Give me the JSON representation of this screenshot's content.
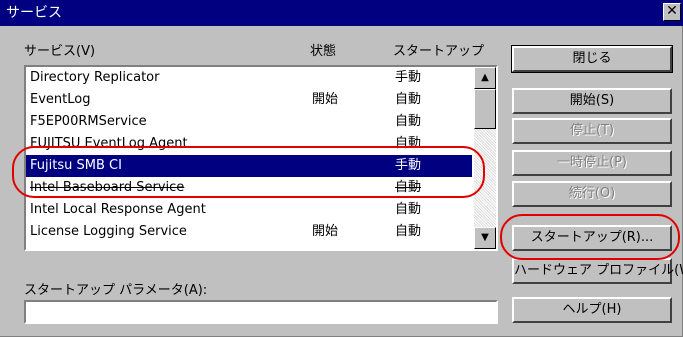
{
  "window": {
    "title": "サービス",
    "close_glyph": "✕"
  },
  "list": {
    "label": "サービス(V)",
    "headers": {
      "name": "サービス(V)",
      "status": "状態",
      "startup": "スタートアップ"
    },
    "rows": [
      {
        "name": "Directory Replicator",
        "status": "",
        "startup": "手動"
      },
      {
        "name": "EventLog",
        "status": "開始",
        "startup": "自動"
      },
      {
        "name": "F5EP00RMService",
        "status": "",
        "startup": "自動"
      },
      {
        "name": "FUJITSU EventLog Agent",
        "status": "",
        "startup": "自動"
      },
      {
        "name": "Fujitsu SMB CI",
        "status": "",
        "startup": "手動"
      },
      {
        "name": "Intel Baseboard Service",
        "status": "",
        "startup": "自動"
      },
      {
        "name": "Intel Local Response Agent",
        "status": "",
        "startup": "自動"
      },
      {
        "name": "License Logging Service",
        "status": "開始",
        "startup": "自動"
      }
    ],
    "selected_index": 4
  },
  "buttons": {
    "close": "閉じる",
    "start": "開始(S)",
    "stop": "停止(T)",
    "pause": "一時停止(P)",
    "resume": "続行(O)",
    "startup": "スタートアップ(R)...",
    "hw_profiles": "ハードウェア プロファイル(W)...",
    "help": "ヘルプ(H)"
  },
  "params": {
    "label": "スタートアップ パラメータ(A):",
    "value": ""
  },
  "colors": {
    "highlight_ring": "#e00000",
    "selection": "#000080",
    "titlebar": "#000080"
  }
}
